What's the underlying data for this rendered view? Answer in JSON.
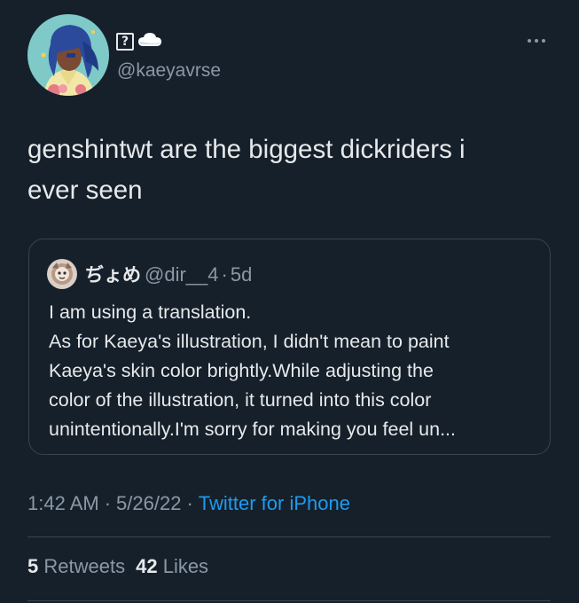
{
  "author": {
    "display_name_glyph": "?",
    "display_name_emoji": "cloud-emoji",
    "handle": "@kaeyavrse",
    "avatar": "anime-character-avatar"
  },
  "tweet": {
    "text_lines": [
      "genshintwt are the biggest dickriders i",
      "ever seen"
    ]
  },
  "quote": {
    "display_name": "ぢょめ",
    "handle": "@dir__4",
    "separator": "·",
    "time": "5d",
    "text_lines": [
      "I am using a translation.",
      "As for Kaeya's illustration, I didn't mean to paint",
      "Kaeya's skin color brightly.While adjusting the",
      "color of the illustration, it turned into this color",
      "unintentionally.I'm sorry for making you feel un..."
    ]
  },
  "meta": {
    "time": "1:42 AM",
    "date": "5/26/22",
    "separator": "·",
    "source": "Twitter for iPhone"
  },
  "stats": {
    "retweets_count": "5",
    "retweets_label": "Retweets",
    "likes_count": "42",
    "likes_label": "Likes"
  },
  "colors": {
    "background": "#15202b",
    "text": "#e7e9ea",
    "secondary": "#8b98a5",
    "accent": "#1d9bf0",
    "border": "#38444d"
  }
}
